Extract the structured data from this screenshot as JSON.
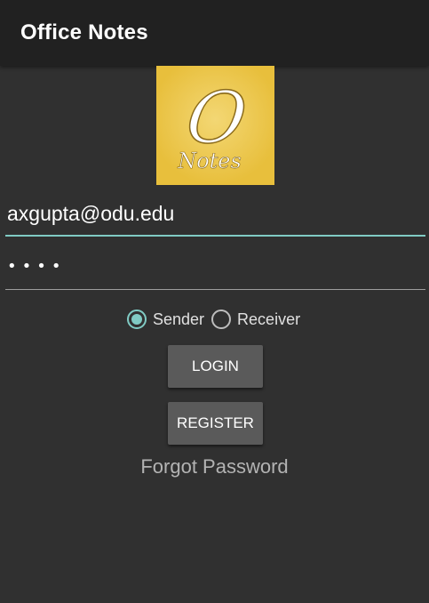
{
  "app_bar": {
    "title": "Office Notes"
  },
  "logo": {
    "letter": "O",
    "word": "Notes",
    "color": "#e8bf3c"
  },
  "form": {
    "email_value": "axgupta@odu.edu",
    "password_value": "••••",
    "role_options": [
      {
        "label": "Sender",
        "selected": true
      },
      {
        "label": "Receiver",
        "selected": false
      }
    ],
    "login_label": "LOGIN",
    "register_label": "REGISTER",
    "forgot_label": "Forgot Password"
  },
  "colors": {
    "background": "#303030",
    "app_bar": "#212121",
    "accent": "#80cbc4",
    "button": "#5a5a5a"
  }
}
